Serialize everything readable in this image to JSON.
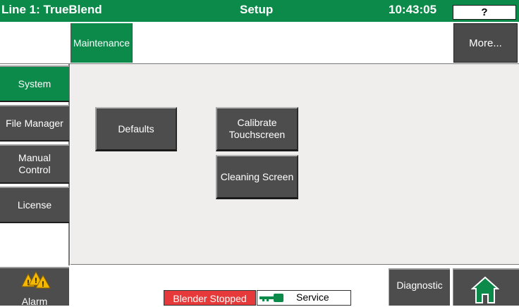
{
  "header": {
    "line_title": "Line 1: TrueBlend",
    "screen_title": "Setup",
    "clock": "10:43:05",
    "help_label": "?"
  },
  "subheader": {
    "active_tab": "Maintenance",
    "more_label": "More..."
  },
  "sidebar": {
    "items": [
      {
        "label": "System",
        "active": true
      },
      {
        "label": "File Manager",
        "active": false
      },
      {
        "label": "Manual Control",
        "active": false
      },
      {
        "label": "License",
        "active": false
      }
    ]
  },
  "main": {
    "buttons": {
      "defaults": "Defaults",
      "calibrate": "Calibrate Touchscreen",
      "cleaning": "Cleaning Screen"
    }
  },
  "footer": {
    "alarm_label": "Alarm",
    "alarm_icon": "warning-triangles-icon",
    "blender_status": "Blender Stopped",
    "access_level": "Service",
    "access_icon": "key-icon",
    "diagnostic_label": "Diagnostic",
    "home_icon": "home-icon"
  },
  "colors": {
    "brand_green": "#0b8a4a",
    "button_gray": "#4d4d4d",
    "status_red": "#e63a3a",
    "alarm_yellow": "#f5b800"
  }
}
